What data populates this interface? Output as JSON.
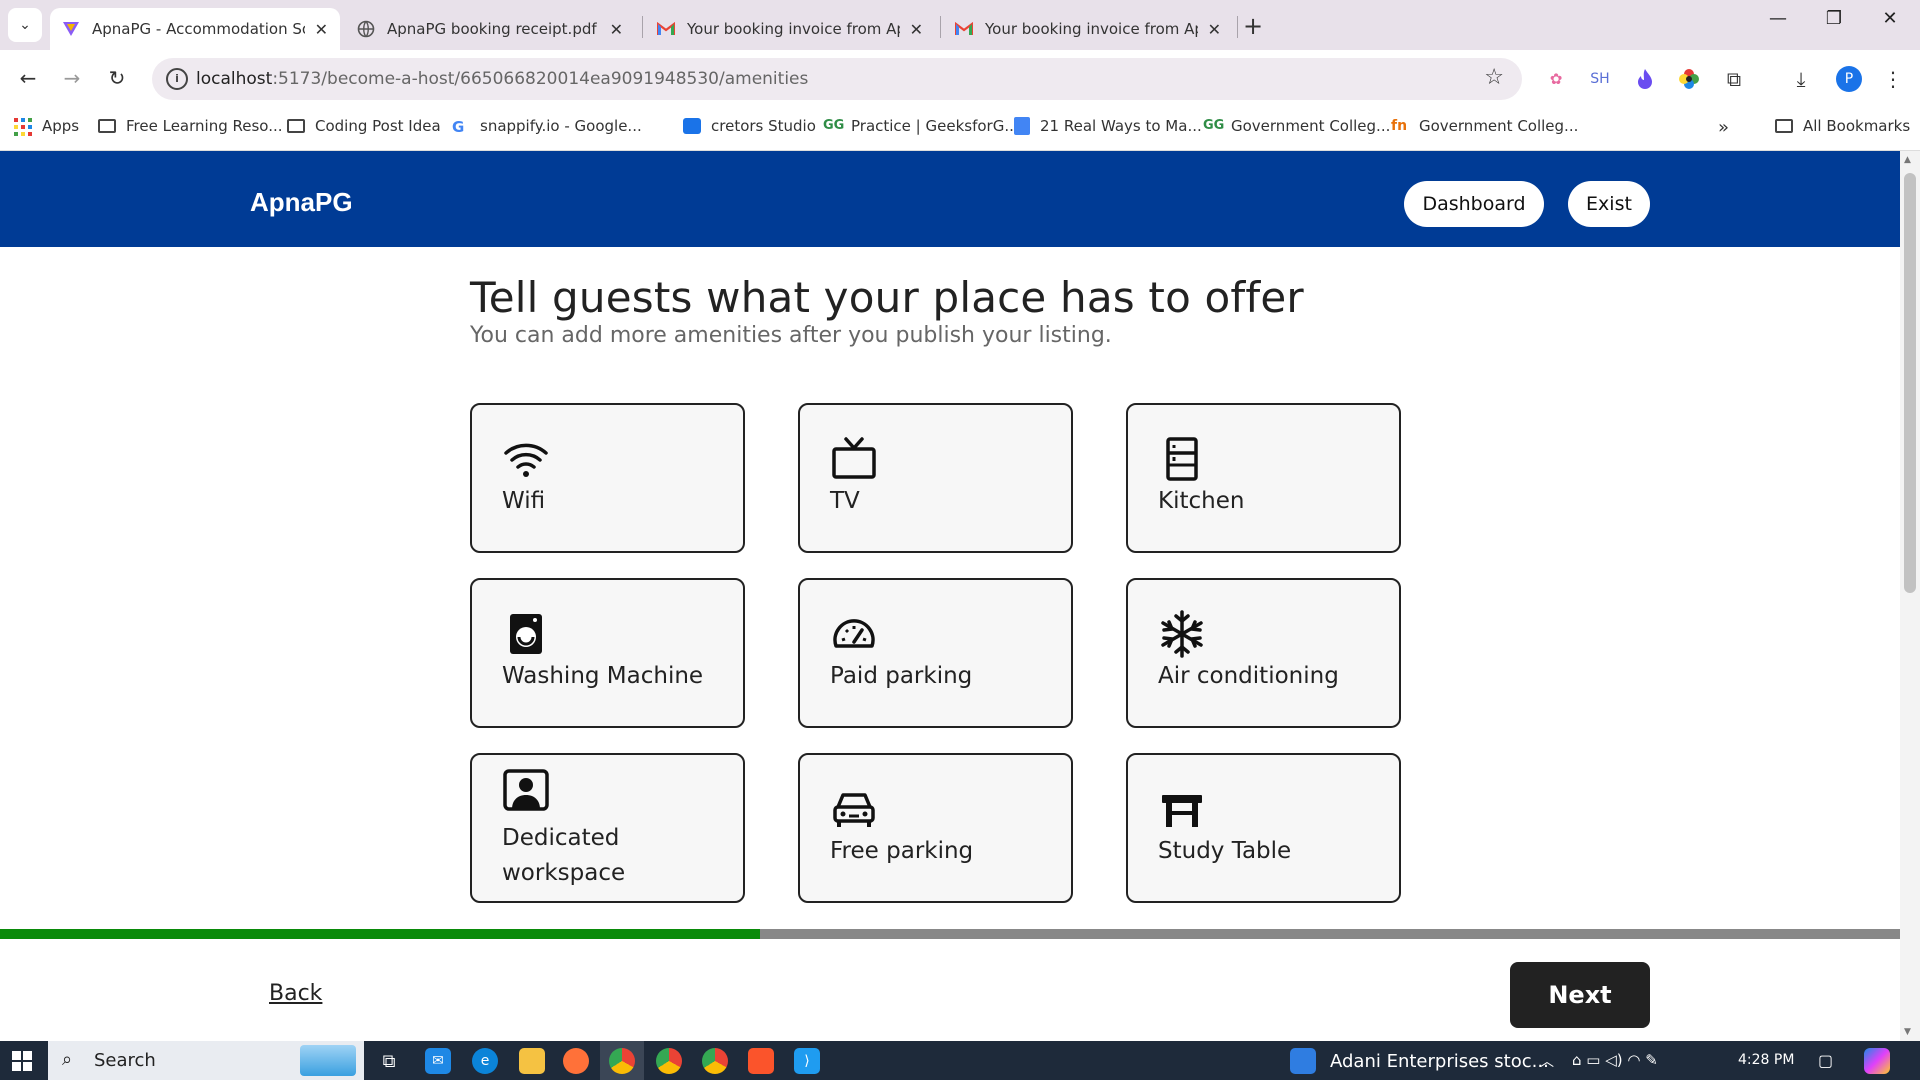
{
  "browser": {
    "tabs": [
      {
        "title": "ApnaPG - Accommodation Solu",
        "favicon": "apnapg-logo-icon",
        "active": true
      },
      {
        "title": "ApnaPG booking receipt.pdf",
        "favicon": "globe-icon",
        "active": false
      },
      {
        "title": "Your booking invoice from Apn",
        "favicon": "gmail-icon",
        "active": false
      },
      {
        "title": "Your booking invoice from Apn",
        "favicon": "gmail-icon",
        "active": false
      }
    ],
    "url_host": "localhost",
    "url_path": ":5173/become-a-host/665066820014ea9091948530/amenities",
    "extension_labels": {
      "sh": "SH",
      "profile": "P"
    },
    "bookmarks": [
      {
        "label": "Apps",
        "icon": "apps-grid-icon"
      },
      {
        "label": "Free Learning Reso...",
        "icon": "folder-icon"
      },
      {
        "label": "Coding Post Idea",
        "icon": "folder-icon"
      },
      {
        "label": "snappify.io - Google...",
        "icon": "google-icon"
      },
      {
        "label": "cretors Studio",
        "icon": "studio-icon"
      },
      {
        "label": "Practice | GeeksforG...",
        "icon": "gfg-icon"
      },
      {
        "label": "21 Real Ways to Ma...",
        "icon": "docs-icon"
      },
      {
        "label": "Government Colleg...",
        "icon": "gfg-icon"
      },
      {
        "label": "Government Colleg...",
        "icon": "college-icon"
      }
    ],
    "all_bookmarks": "All Bookmarks"
  },
  "app": {
    "logo": "ApnaPG",
    "header_buttons": {
      "dashboard": "Dashboard",
      "exit": "Exist"
    },
    "heading": "Tell guests what your place has to offer",
    "subheading": "You can add more amenities after you publish your listing.",
    "amenities": [
      {
        "label": "Wifi",
        "icon": "wifi-icon"
      },
      {
        "label": "TV",
        "icon": "tv-icon"
      },
      {
        "label": "Kitchen",
        "icon": "kitchen-icon"
      },
      {
        "label": "Washing Machine",
        "icon": "washing-machine-icon"
      },
      {
        "label": "Paid parking",
        "icon": "gauge-icon"
      },
      {
        "label": "Air conditioning",
        "icon": "snowflake-icon"
      },
      {
        "label": "Dedicated workspace",
        "icon": "workspace-icon"
      },
      {
        "label": "Free parking",
        "icon": "car-icon"
      },
      {
        "label": "Study Table",
        "icon": "table-icon"
      }
    ],
    "progress_fraction": 0.4,
    "back": "Back",
    "next": "Next"
  },
  "taskbar": {
    "search": "Search",
    "news": "Adani Enterprises stoc...",
    "time": "4:28 PM"
  },
  "colors": {
    "header_bg": "#003b95",
    "progress_fill": "#0a8a0a",
    "next_bg": "#222222"
  }
}
